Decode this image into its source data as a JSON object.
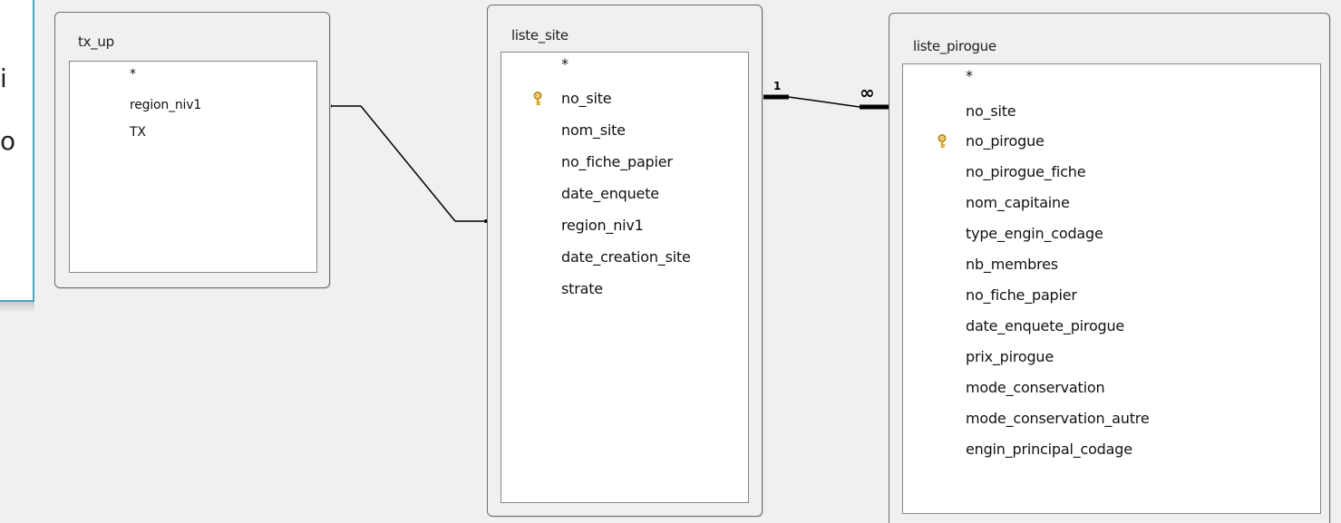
{
  "side_panel": {
    "glyphs": [
      "i",
      "o"
    ]
  },
  "tables": {
    "tx_up": {
      "title": "tx_up",
      "fields": [
        {
          "name": "*",
          "is_key": false
        },
        {
          "name": "region_niv1",
          "is_key": false
        },
        {
          "name": "TX",
          "is_key": false
        }
      ]
    },
    "liste_site": {
      "title": "liste_site",
      "fields": [
        {
          "name": "*",
          "is_key": false
        },
        {
          "name": "no_site",
          "is_key": true
        },
        {
          "name": "nom_site",
          "is_key": false
        },
        {
          "name": "no_fiche_papier",
          "is_key": false
        },
        {
          "name": "date_enquete",
          "is_key": false
        },
        {
          "name": "region_niv1",
          "is_key": false
        },
        {
          "name": "date_creation_site",
          "is_key": false
        },
        {
          "name": "strate",
          "is_key": false
        }
      ]
    },
    "liste_pirogue": {
      "title": "liste_pirogue",
      "fields": [
        {
          "name": "*",
          "is_key": false
        },
        {
          "name": "no_site",
          "is_key": false
        },
        {
          "name": "no_pirogue",
          "is_key": true
        },
        {
          "name": "no_pirogue_fiche",
          "is_key": false
        },
        {
          "name": "nom_capitaine",
          "is_key": false
        },
        {
          "name": "type_engin_codage",
          "is_key": false
        },
        {
          "name": "nb_membres",
          "is_key": false
        },
        {
          "name": "no_fiche_papier",
          "is_key": false
        },
        {
          "name": "date_enquete_pirogue",
          "is_key": false
        },
        {
          "name": "prix_pirogue",
          "is_key": false
        },
        {
          "name": "mode_conservation",
          "is_key": false
        },
        {
          "name": "mode_conservation_autre",
          "is_key": false
        },
        {
          "name": "engin_principal_codage",
          "is_key": false
        }
      ]
    }
  },
  "relationships": {
    "one_label": "1",
    "many_label": "∞"
  },
  "colors": {
    "key_icon": "#d8a520",
    "side_accent": "#4aa6c4"
  }
}
